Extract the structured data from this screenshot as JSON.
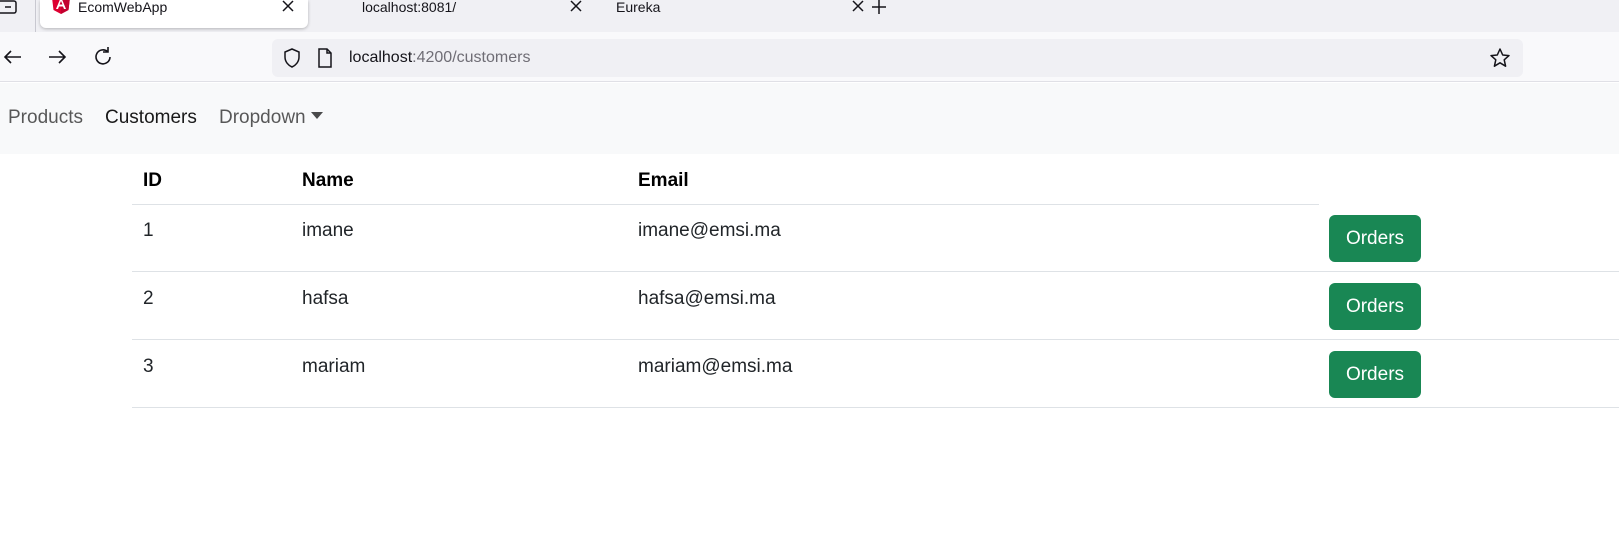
{
  "browser": {
    "tabs": [
      {
        "title": "EcomWebApp",
        "active": true,
        "favicon": "angular-icon"
      },
      {
        "title": "localhost:8081/",
        "active": false
      },
      {
        "title": "Eureka",
        "active": false
      }
    ],
    "url": {
      "host": "localhost",
      "path": ":4200/customers"
    }
  },
  "navbar": {
    "items": [
      {
        "label": "Products"
      },
      {
        "label": "Customers"
      },
      {
        "label": "Dropdown"
      }
    ]
  },
  "table": {
    "headers": [
      "ID",
      "Name",
      "Email"
    ],
    "rows": [
      {
        "id": "1",
        "name": "imane",
        "email": "imane@emsi.ma",
        "action": "Orders"
      },
      {
        "id": "2",
        "name": "hafsa",
        "email": "hafsa@emsi.ma",
        "action": "Orders"
      },
      {
        "id": "3",
        "name": "mariam",
        "email": "mariam@emsi.ma",
        "action": "Orders"
      }
    ]
  },
  "colors": {
    "button_success": "#198754",
    "navbar_bg": "#f8f9fa",
    "tabstrip_bg": "#f0f0f4",
    "angular_brand": "#dd0031"
  }
}
